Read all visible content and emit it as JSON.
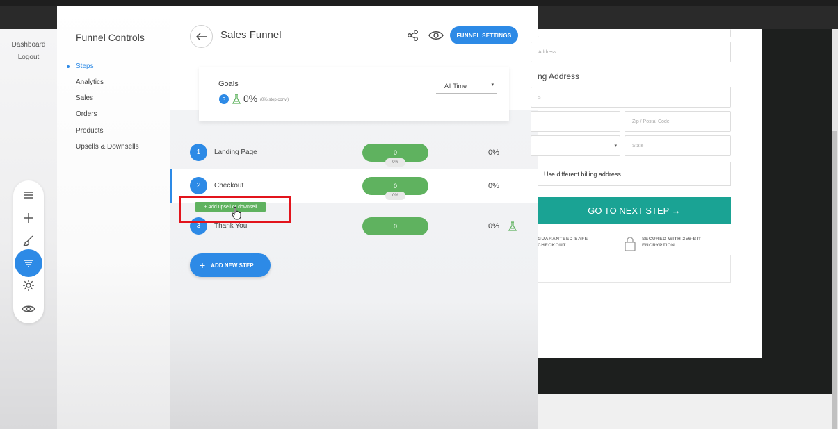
{
  "nav": {
    "dashboard": "Dashboard",
    "logout": "Logout"
  },
  "tools": [
    "menu-icon",
    "plus-icon",
    "brush-icon",
    "funnel-icon",
    "gear-icon",
    "eye-icon"
  ],
  "controls": {
    "title": "Funnel Controls",
    "items": [
      {
        "label": "Steps",
        "active": true
      },
      {
        "label": "Analytics"
      },
      {
        "label": "Sales"
      },
      {
        "label": "Orders"
      },
      {
        "label": "Products"
      },
      {
        "label": "Upsells & Downsells"
      }
    ]
  },
  "header": {
    "title": "Sales Funnel",
    "settings_label": "FUNNEL SETTINGS"
  },
  "goals": {
    "title": "Goals",
    "count": "3",
    "percent": "0%",
    "sub": "(0% step conv.)",
    "time_range": "All Time",
    "caret": "▾"
  },
  "steps": [
    {
      "num": "1",
      "name": "Landing Page",
      "bar": "0",
      "mini": "0%",
      "pct": "0%"
    },
    {
      "num": "2",
      "name": "Checkout",
      "bar": "0",
      "mini": "0%",
      "pct": "0%"
    },
    {
      "num": "3",
      "name": "Thank You",
      "bar": "0",
      "pct": "0%"
    }
  ],
  "upsell_tag": "+ Add upsell or downsell",
  "add_step_label": "ADD NEW STEP",
  "preview": {
    "address_placeholder": "Address",
    "heading": "ng Address",
    "field2_placeholder": "s",
    "zip_placeholder": "Zip / Postal Code",
    "state_placeholder": "State",
    "billing_label": "Use different billing address",
    "cta": "GO TO NEXT STEP →",
    "badge_safe": "GUARANTEED SAFE\nCHECKOUT",
    "badge_secure": "SECURED WITH 256-BIT\nENCRYPTION"
  },
  "colors": {
    "primary": "#2d8ae6",
    "success": "#5fb25f",
    "cta": "#1aa394",
    "highlight": "#e2141c"
  }
}
